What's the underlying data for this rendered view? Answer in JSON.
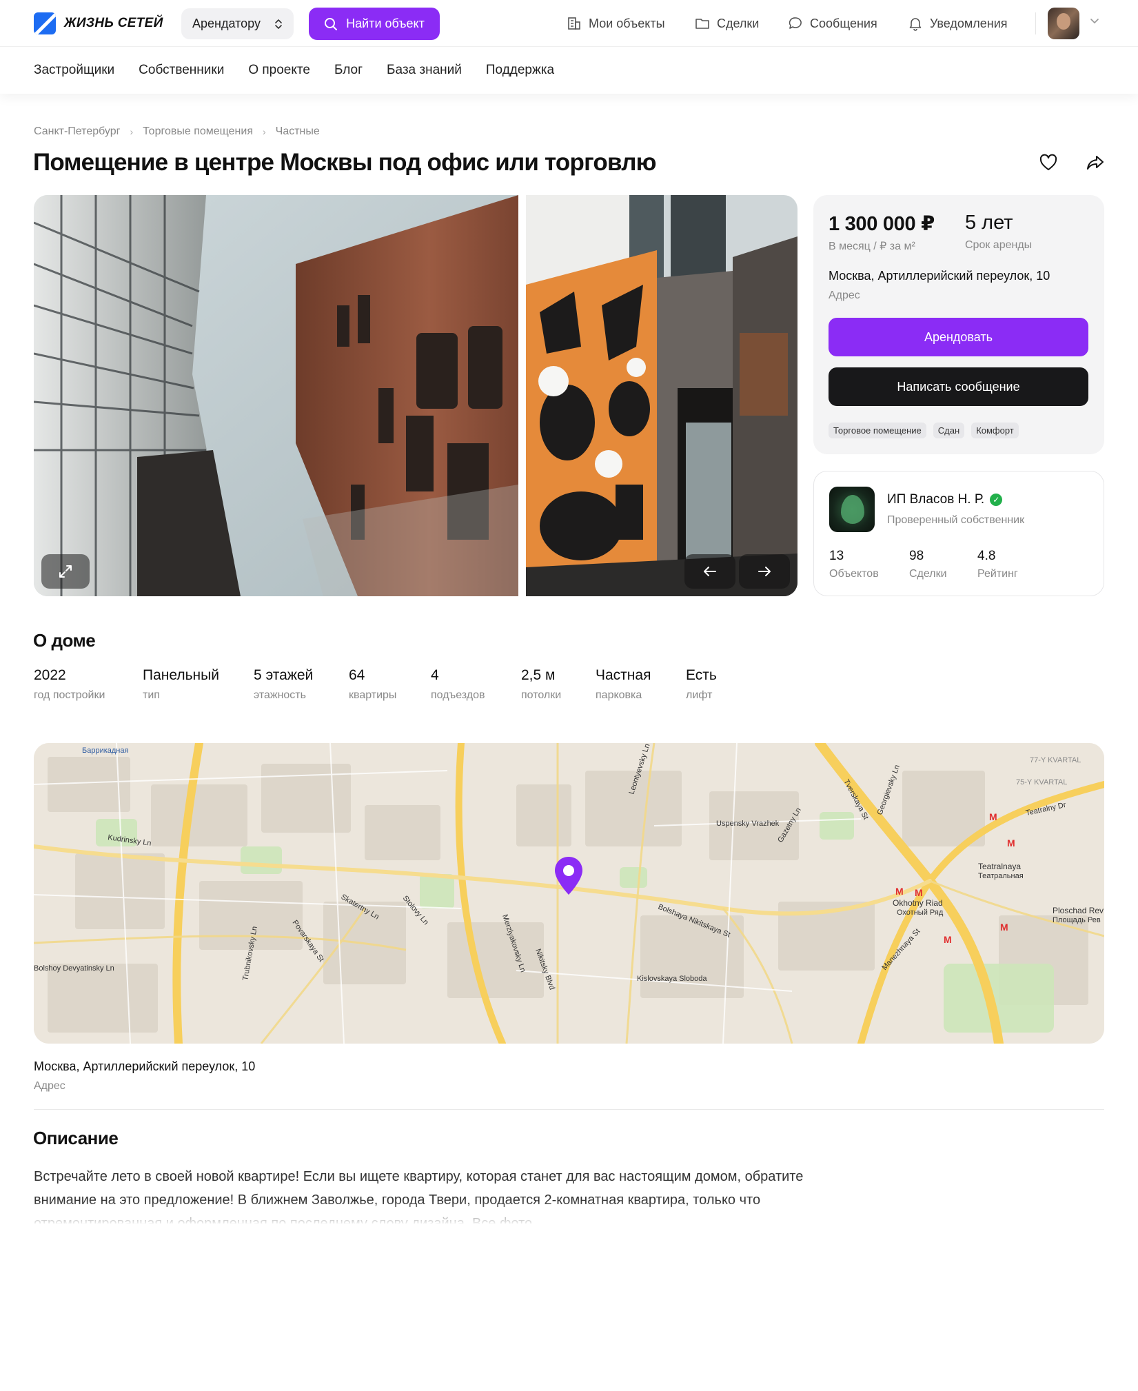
{
  "header": {
    "logo_text": "ЖИЗНЬ СЕТЕЙ",
    "role_select": "Арендатору",
    "find_button": "Найти объект",
    "nav": [
      {
        "label": "Мои объекты",
        "icon": "building-icon"
      },
      {
        "label": "Сделки",
        "icon": "folder-icon"
      },
      {
        "label": "Сообщения",
        "icon": "chat-icon"
      },
      {
        "label": "Уведомления",
        "icon": "bell-icon"
      }
    ],
    "subnav": [
      "Застройщики",
      "Собственники",
      "О проекте",
      "Блог",
      "База знаний",
      "Поддержка"
    ]
  },
  "breadcrumb": [
    "Санкт-Петербург",
    "Торговые помещения",
    "Частные"
  ],
  "title": "Помещение в центре Москвы под офис или торговлю",
  "price_card": {
    "price": "1 300 000 ₽",
    "price_sub": "В месяц / ₽ за м²",
    "term": "5 лет",
    "term_sub": "Срок аренды",
    "address": "Москва, Артиллерийский переулок, 10",
    "address_label": "Адрес",
    "rent_button": "Арендовать",
    "message_button": "Написать сообщение",
    "tags": [
      "Торговое помещение",
      "Сдан",
      "Комфорт"
    ]
  },
  "owner": {
    "name": "ИП Власов Н. Р.",
    "status": "Проверенный собственник",
    "stats": [
      {
        "value": "13",
        "label": "Объектов"
      },
      {
        "value": "98",
        "label": "Сделки"
      },
      {
        "value": "4.8",
        "label": "Рейтинг"
      }
    ]
  },
  "about": {
    "title": "О доме",
    "stats": [
      {
        "value": "2022",
        "label": "год постройки"
      },
      {
        "value": "Панельный",
        "label": "тип"
      },
      {
        "value": "5 этажей",
        "label": "этажность"
      },
      {
        "value": "64",
        "label": "квартиры"
      },
      {
        "value": "4",
        "label": "подъездов"
      },
      {
        "value": "2,5 м",
        "label": "потолки"
      },
      {
        "value": "Частная",
        "label": "парковка"
      },
      {
        "value": "Есть",
        "label": "лифт"
      }
    ]
  },
  "map": {
    "address": "Москва, Артиллерийский переулок, 10",
    "address_label": "Адрес",
    "labels": [
      "Tverskaya St",
      "Bolshaya Nikitskaya St",
      "Povarskaya St",
      "Kudrinsky Ln",
      "Nikitsky Blvd",
      "Teatralnaya",
      "Театральная",
      "Okhotny Riad",
      "Охотный Ряд",
      "Ploschad Rev",
      "Площадь Рев",
      "Uspensky Vrazhek",
      "Kislovskaya Sloboda",
      "Merzlyakovsky Ln",
      "Skatertny Ln",
      "Stolovy Ln",
      "Bolshoy Devyatinsky Ln",
      "Trubnikovsky Ln",
      "Teatralny Dr",
      "75-Y KVARTAL",
      "77-Y KVARTAL",
      "Gazetny Ln",
      "Manezhnaya St",
      "Leontyevsky Ln",
      "Georgievsky Ln",
      "Баррикадная"
    ]
  },
  "description": {
    "title": "Описание",
    "text": "Встречайте лето в своей новой квартире! Если вы ищете квартиру, которая станет для вас настоящим домом, обратите внимание на это предложение! В ближнем Заволжье, города Твери, продается 2-комнатная квартира, только что отремонтированная и оформленная по последнему слову дизайна. Все фото"
  },
  "colors": {
    "accent": "#8b2cf5",
    "dark_button": "#18181a",
    "brand": "#1d6cf2",
    "verified": "#22b04b"
  }
}
